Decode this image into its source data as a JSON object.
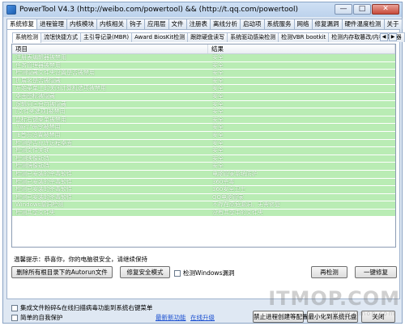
{
  "window": {
    "title": "PowerTool V4.3   (http://weibo.com/powertool) && (http://t.qq.com/powertool)",
    "controls": [
      "—",
      "□",
      "✕"
    ]
  },
  "main_tabs": [
    "系统修复",
    "进程管理",
    "内核模块",
    "内核相关",
    "钩子",
    "应用层",
    "文件",
    "注册表",
    "离线分析",
    "启动项",
    "系统服务",
    "网络",
    "修复漏洞",
    "硬件温度检测",
    "关于"
  ],
  "sub_tabs": [
    "系统检测",
    "流氓快捷方式",
    "主引导记录(MBR)",
    "Award BiosKit检测",
    "跟踪硬盘读写",
    "系统驱动感染检测",
    "检测VBR bootkit",
    "检测内存取篡改/内核调试器"
  ],
  "list": {
    "headers": [
      "项目",
      "结果"
    ],
    "rows": [
      [
        "注册表编辑器被禁用",
        "安全"
      ],
      [
        "任务管理器被禁用",
        "安全"
      ],
      [
        "检测隐藏文件夹设置是否被禁用",
        "安全"
      ],
      [
        "扩展名是否被隐藏",
        "安全"
      ],
      [
        "开始菜单上的关闭计算机选项被禁用",
        "安全"
      ],
      [
        "桌面图标被隐藏",
        "安全"
      ],
      [
        "逻辑分区盘符被隐藏",
        "安全"
      ],
      [
        "[文件夹选项]被禁用",
        "安全"
      ],
      [
        "鼠标右键菜单被禁用",
        "安全"
      ],
      [
        "\"运行\"命令被禁用",
        "安全"
      ],
      [
        "IE首页设置被禁用",
        "安全"
      ],
      [
        "检测是否允许远程桌面",
        "安全"
      ],
      [
        "检测文件关联",
        "安全"
      ],
      [
        "检测映像劫持",
        "安全"
      ],
      [
        "检测镜像劫持",
        "安全"
      ],
      [
        "检测已安装的杀毒软件",
        "电脑管家系统防护"
      ],
      [
        "检测已安装的杀毒软件",
        "360杀毒"
      ],
      [
        "检测已安装的杀毒软件",
        "360安全卫士"
      ],
      [
        "检测已安装的杀毒软件",
        "QQ电脑管家"
      ],
      [
        "Windows漏洞检测",
        "不存在高危漏洞，无需修复"
      ],
      [
        "检测共享文件夹",
        "没有共享中的文件夹"
      ]
    ]
  },
  "hint": "温馨提示：恭喜你，你的电脑很安全，请继续保持",
  "buttons": {
    "delete_autorun": "删除所有根目录下的Autorun文件",
    "repair_safe_mode": "修复安全模式",
    "recheck": "再检测",
    "one_click_repair": "一键修复",
    "forbid_process": "禁止进程创建等配置",
    "minimize_tray": "最小化到系统托盘",
    "close": "关闭"
  },
  "checkboxes": {
    "detect_windows_vuln": "检测Windows漏洞",
    "integrate_menu": "集成文件粉碎&在线扫描病毒功能到系统右键菜单",
    "self_protect": "简单的自我保护"
  },
  "links": {
    "new_features": "最新新功能",
    "online_upgrade": "在线升级"
  },
  "watermark": {
    "main": "ITMOP.COM",
    "sub": "www.itmop.com"
  }
}
